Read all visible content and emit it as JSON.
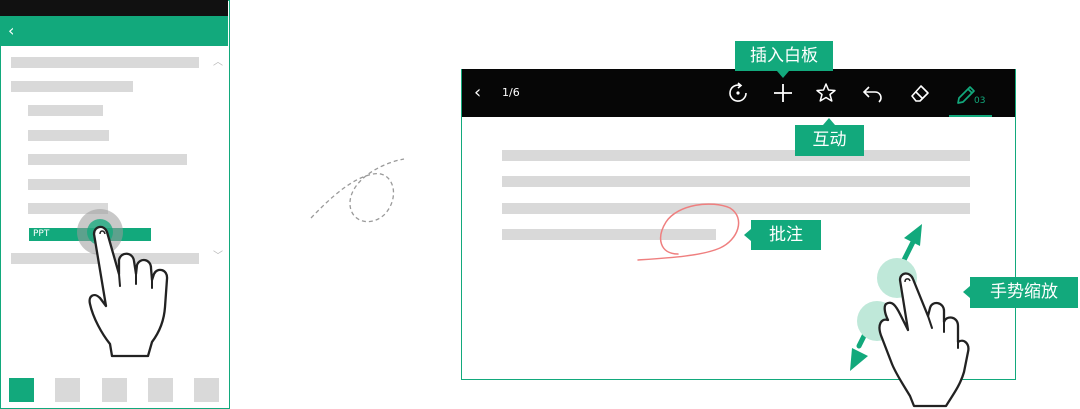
{
  "phone": {
    "back_icon": "chevron-left-icon",
    "ppt_label": "PPT",
    "tabs": [
      "tab-1",
      "tab-2",
      "tab-3",
      "tab-4",
      "tab-5"
    ]
  },
  "whiteboard": {
    "page_count": "1/6",
    "pen_count": "03",
    "tools": [
      "rotate-icon",
      "plus-icon",
      "interaction-icon",
      "undo-icon",
      "eraser-icon",
      "pen-icon"
    ]
  },
  "callouts": {
    "insert_whiteboard": "插入白板",
    "interaction": "互动",
    "annotation": "批注",
    "gesture_zoom": "手势缩放"
  },
  "colors": {
    "accent": "#12a97c",
    "toolbar": "#060606",
    "placeholder": "#d9d9d9",
    "annotation_stroke": "#ef7f7f"
  }
}
